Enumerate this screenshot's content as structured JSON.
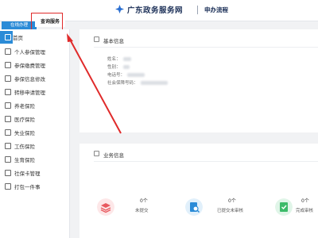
{
  "header": {
    "site_title": "广东政务服务网",
    "nav_link": "申办流程"
  },
  "tabs": {
    "online": "在线办理",
    "query": "查询服务"
  },
  "sidebar": {
    "items": [
      {
        "label": "首页",
        "icon": "home-icon"
      },
      {
        "label": "个人参保管理",
        "icon": "person-icon"
      },
      {
        "label": "参保缴费管理",
        "icon": "payment-icon"
      },
      {
        "label": "参保信息修改",
        "icon": "edit-icon"
      },
      {
        "label": "转移申请管理",
        "icon": "transfer-icon"
      },
      {
        "label": "养老保险",
        "icon": "pension-icon"
      },
      {
        "label": "医疗保险",
        "icon": "medical-icon"
      },
      {
        "label": "失业保险",
        "icon": "unemployment-icon"
      },
      {
        "label": "工伤保险",
        "icon": "injury-icon"
      },
      {
        "label": "生育保险",
        "icon": "maternity-icon"
      },
      {
        "label": "社保卡管理",
        "icon": "card-icon"
      },
      {
        "label": "打包一件事",
        "icon": "package-icon"
      }
    ]
  },
  "basic_info": {
    "title": "基本信息",
    "fields": [
      {
        "label": "姓名："
      },
      {
        "label": "性别："
      },
      {
        "label": "电话号："
      },
      {
        "label": "社会保障号码："
      }
    ]
  },
  "business_info": {
    "title": "业务信息",
    "stats": [
      {
        "count": "0个",
        "label": "未提交",
        "icon": "stack-icon",
        "color": "#e8595f"
      },
      {
        "count": "0个",
        "label": "已提交未审核",
        "icon": "search-doc-icon",
        "color": "#2b8bd7"
      },
      {
        "count": "0个",
        "label": "完成审核",
        "icon": "check-doc-icon",
        "color": "#3dbb6a"
      }
    ]
  },
  "colors": {
    "accent": "#2b8bd7",
    "highlight": "#e02a2a"
  }
}
